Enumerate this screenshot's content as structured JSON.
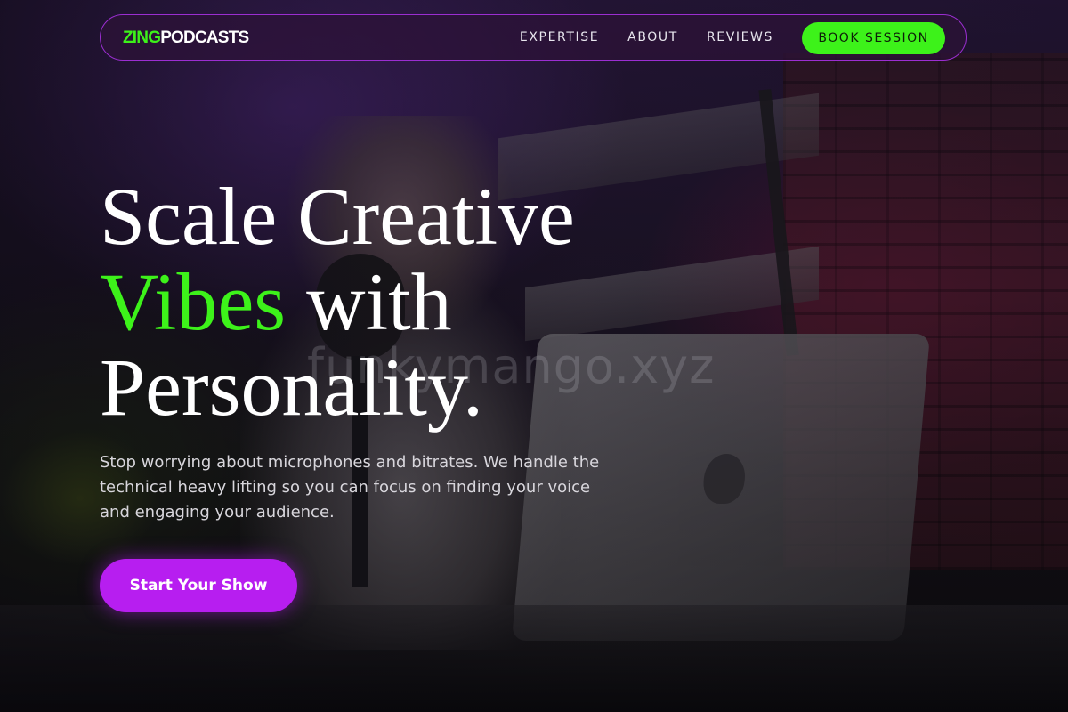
{
  "brand": {
    "accent_word": "ZING",
    "main_word": "PODCASTS"
  },
  "nav": {
    "links": [
      {
        "label": "EXPERTISE"
      },
      {
        "label": "ABOUT"
      },
      {
        "label": "REVIEWS"
      }
    ],
    "cta_label": "BOOK SESSION"
  },
  "hero": {
    "headline_line1": "Scale Creative",
    "headline_accent": "Vibes",
    "headline_line2_rest": " with",
    "headline_line3": "Personality.",
    "subtitle": "Stop worrying about microphones and bitrates. We handle the technical heavy lifting so you can focus on finding your voice and engaging your audience.",
    "cta_label": "Start Your Show"
  },
  "watermark": "funkymango.xyz",
  "colors": {
    "accent_green": "#3df21a",
    "accent_purple": "#b71ef0",
    "nav_border": "#9b2ed1",
    "headline_white": "#ffffff"
  }
}
